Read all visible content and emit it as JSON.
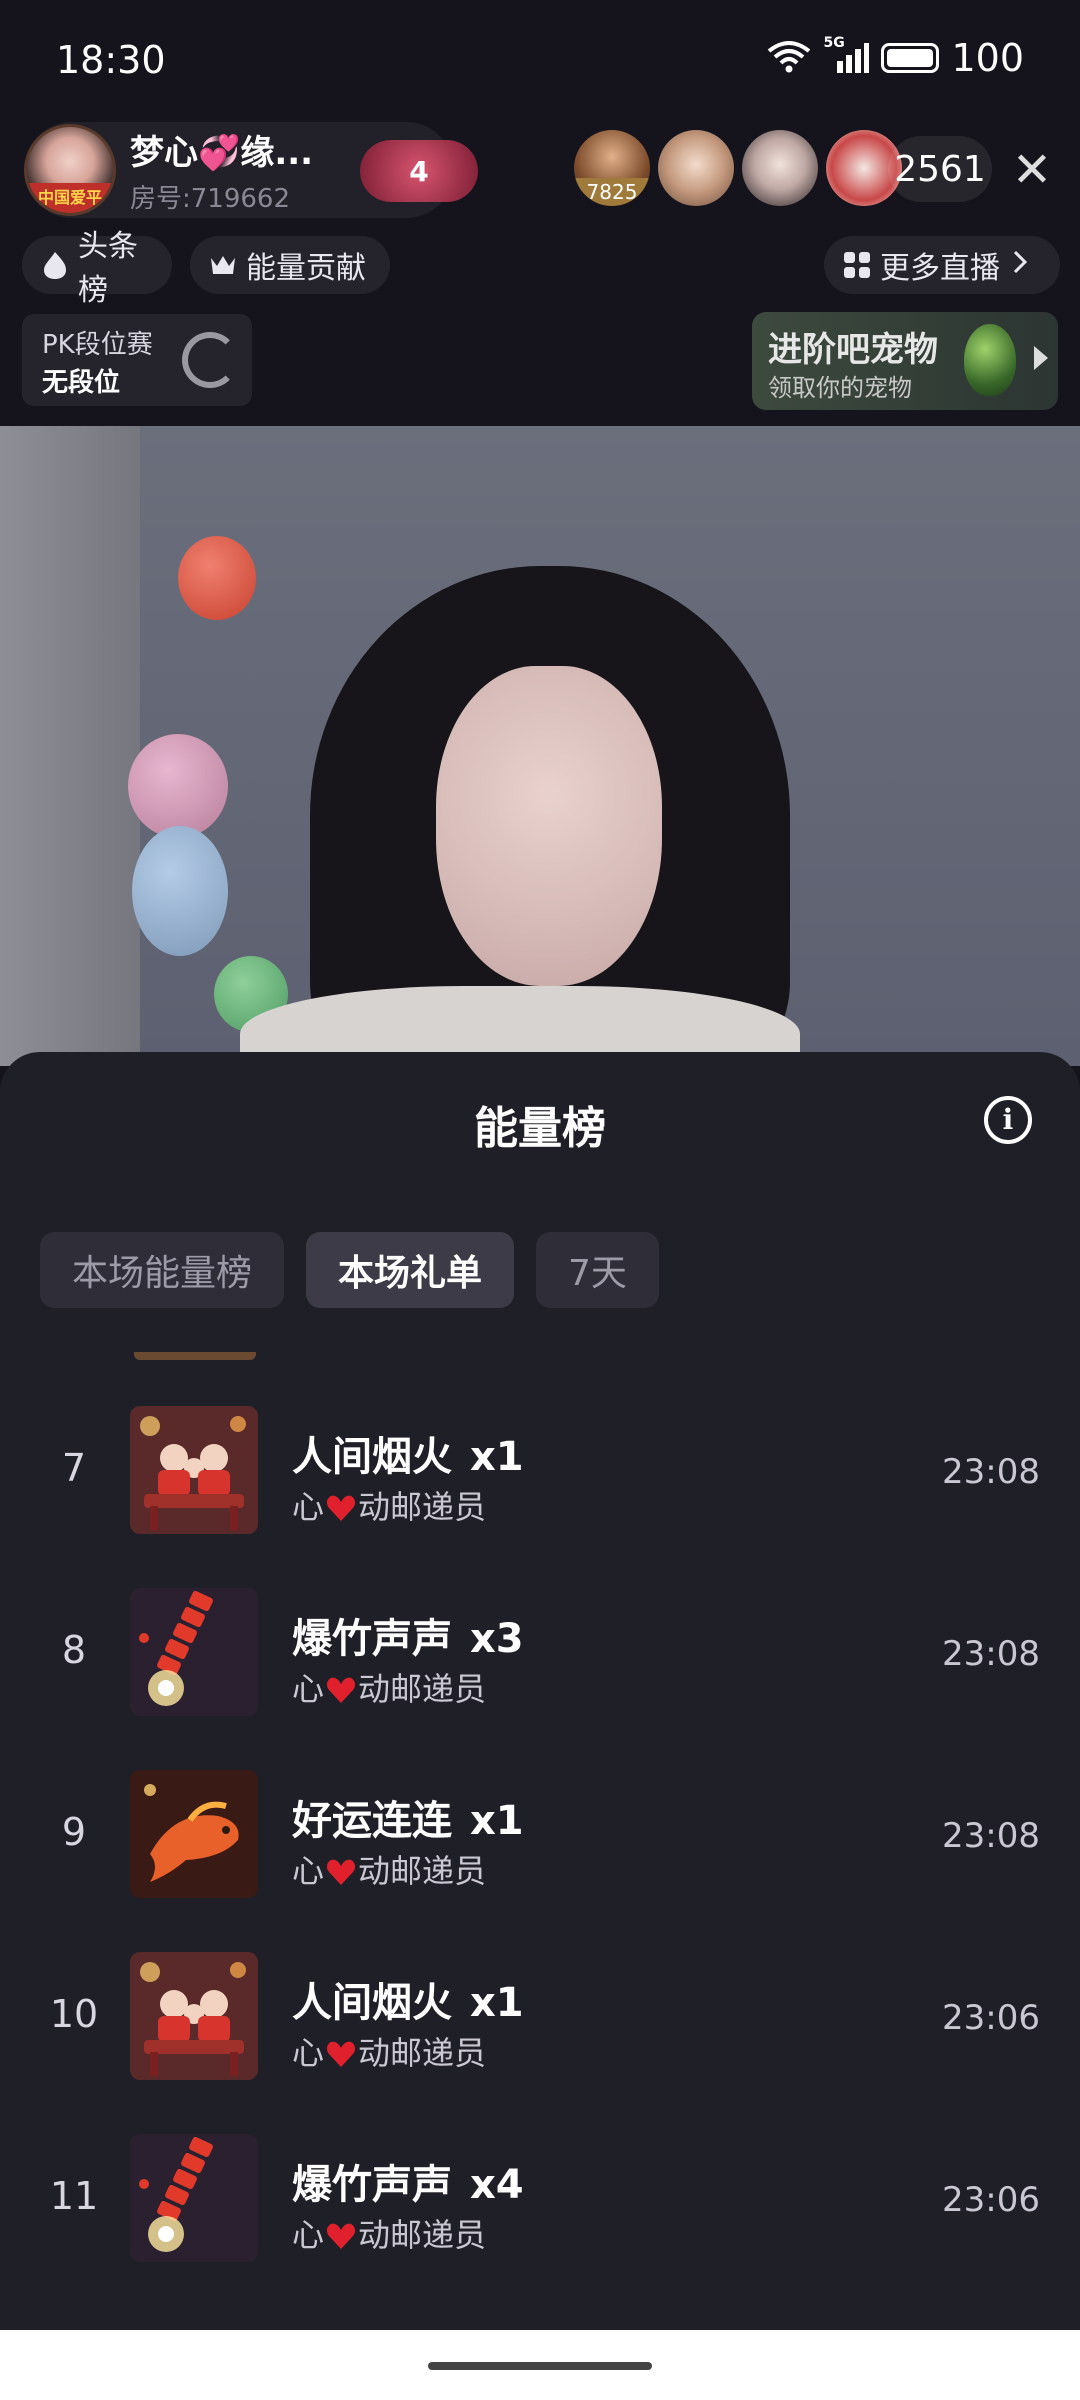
{
  "status_bar": {
    "time": "18:30",
    "network": "5G",
    "battery": "100"
  },
  "header": {
    "host_name": "梦心💞缘...",
    "room_label": "房号:719662",
    "host_badge": "中国爱平",
    "heart_level": "4",
    "viewer_level": "7825",
    "viewer_count": "2561",
    "close_label": "✕"
  },
  "chips": {
    "headline": "头条榜",
    "energy": "能量贡献",
    "more_live": "更多直播"
  },
  "pk": {
    "title": "PK段位赛",
    "rank": "无段位"
  },
  "pet_banner": {
    "title": "进阶吧宠物",
    "subtitle": "领取你的宠物"
  },
  "sheet": {
    "title": "能量榜",
    "info": "i",
    "tabs": [
      "本场能量榜",
      "本场礼单",
      "7天"
    ],
    "active_tab": "本场礼单"
  },
  "gift_list": [
    {
      "rank": "7",
      "gift": "人间烟火",
      "qty": "x1",
      "sender_pre": "心",
      "sender_post": "动邮递员",
      "time": "23:08",
      "thumb": "family-dinner"
    },
    {
      "rank": "8",
      "gift": "爆竹声声",
      "qty": "x3",
      "sender_pre": "心",
      "sender_post": "动邮递员",
      "time": "23:08",
      "thumb": "firecracker"
    },
    {
      "rank": "9",
      "gift": "好运连连",
      "qty": "x1",
      "sender_pre": "心",
      "sender_post": "动邮递员",
      "time": "23:08",
      "thumb": "koi"
    },
    {
      "rank": "10",
      "gift": "人间烟火",
      "qty": "x1",
      "sender_pre": "心",
      "sender_post": "动邮递员",
      "time": "23:06",
      "thumb": "family-dinner"
    },
    {
      "rank": "11",
      "gift": "爆竹声声",
      "qty": "x4",
      "sender_pre": "心",
      "sender_post": "动邮递员",
      "time": "23:06",
      "thumb": "firecracker"
    }
  ],
  "colors": {
    "sheet_bg": "#1f1f27",
    "tab_active_bg": "#3c3b47",
    "heart_red": "#e0212d"
  }
}
